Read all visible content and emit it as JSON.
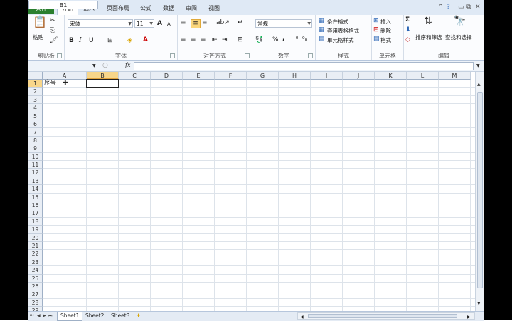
{
  "ribbon_tabs": [
    {
      "label": "文件"
    },
    {
      "label": "开始"
    },
    {
      "label": "插入"
    },
    {
      "label": "页面布局"
    },
    {
      "label": "公式"
    },
    {
      "label": "数据"
    },
    {
      "label": "审阅"
    },
    {
      "label": "视图"
    }
  ],
  "active_tab": "开始",
  "clipboard": {
    "paste_label": "粘贴",
    "group_label": "剪贴板"
  },
  "font": {
    "name": "宋体",
    "size": "11",
    "group_label": "字体",
    "bold": "B",
    "italic": "I",
    "underline": "U",
    "grow": "A",
    "shrink": "A"
  },
  "alignment": {
    "group_label": "对齐方式"
  },
  "number": {
    "format": "常规",
    "group_label": "数字",
    "percent": "%",
    "comma": ","
  },
  "styles": {
    "conditional": "条件格式",
    "table_format": "套用表格格式",
    "cell_styles": "单元格样式",
    "group_label": "样式"
  },
  "cells": {
    "insert": "插入",
    "delete": "删除",
    "format": "格式",
    "group_label": "单元格"
  },
  "editing": {
    "sum_symbol": "Σ",
    "sort_filter": "排序和筛选",
    "find_select": "查找和选择",
    "group_label": "编辑"
  },
  "formula_bar": {
    "name_box": "B1",
    "fx": "fx",
    "content": ""
  },
  "grid": {
    "columns": [
      "A",
      "B",
      "C",
      "D",
      "E",
      "F",
      "G",
      "H",
      "I",
      "J",
      "K",
      "L",
      "M"
    ],
    "rows": [
      "1",
      "2",
      "3",
      "4",
      "5",
      "6",
      "7",
      "8",
      "9",
      "10",
      "11",
      "12",
      "13",
      "14",
      "15",
      "16",
      "17",
      "18",
      "19",
      "20",
      "21",
      "22",
      "23",
      "24",
      "25",
      "26",
      "27",
      "28",
      "29"
    ],
    "selected_cell": "B1",
    "cell_A1": "序号"
  },
  "sheets": [
    {
      "label": "Sheet1"
    },
    {
      "label": "Sheet2"
    },
    {
      "label": "Sheet3"
    }
  ],
  "active_sheet": "Sheet1",
  "colors": {
    "file_tab": "#2a7f2e",
    "selection_header": "#f8d68a"
  }
}
